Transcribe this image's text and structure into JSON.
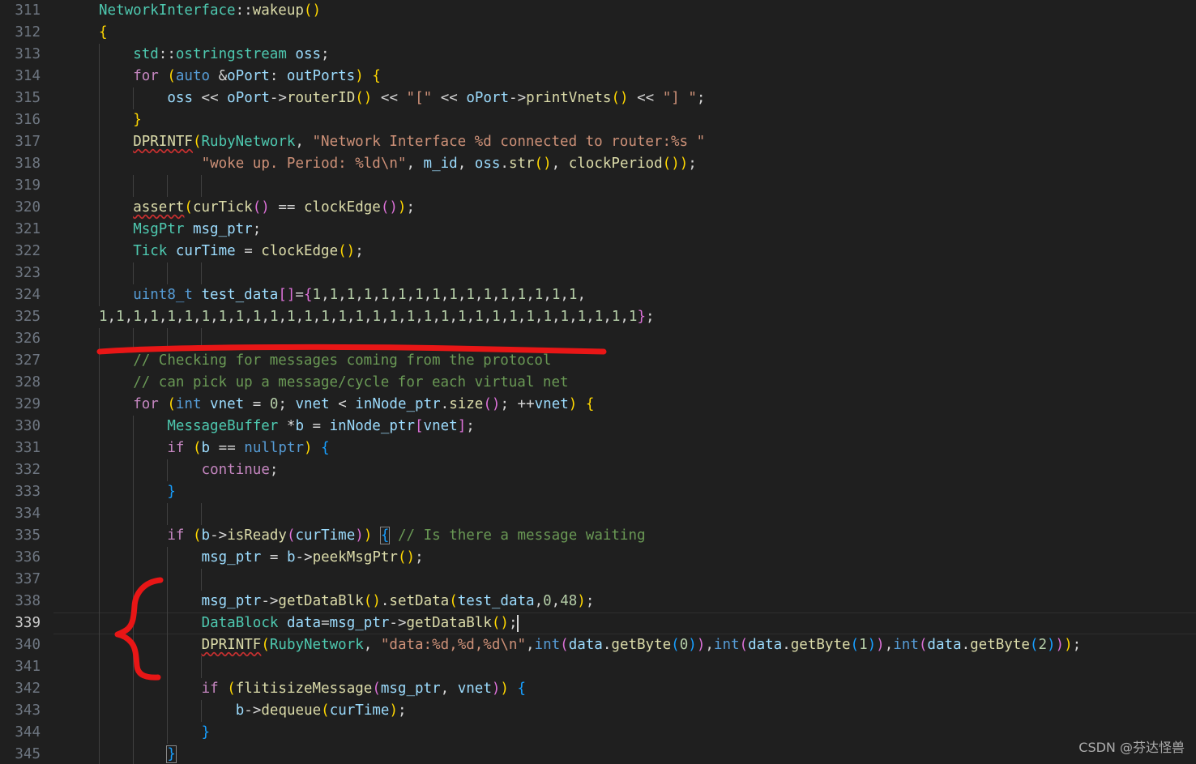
{
  "editor": {
    "language": "cpp",
    "background_color": "#1f1f1f",
    "gutter_color": "#6e7681",
    "active_line_number": 339,
    "first_visible_line": 311,
    "last_visible_line": 345,
    "caret_line": 339,
    "caret_after_text": "DataBlock data=msg_ptr->getDataBlk();"
  },
  "watermark": {
    "text": "CSDN @芬达怪兽"
  },
  "annotations": {
    "underline": {
      "shape": "red-horizontal-underline",
      "color": "#e81616",
      "target_line": 326,
      "description": "Red hand-drawn underline beneath the test_data array declaration"
    },
    "brace": {
      "shape": "red-hand-drawn-curly-brace",
      "color": "#e81616",
      "target_lines": "338-340",
      "description": "Red hand-drawn curly brace marking the three added debug lines"
    }
  },
  "lines": [
    {
      "n": 311,
      "indent": 0,
      "text": "NetworkInterface::wakeup()"
    },
    {
      "n": 312,
      "indent": 0,
      "text": "{"
    },
    {
      "n": 313,
      "indent": 1,
      "text": "std::ostringstream oss;"
    },
    {
      "n": 314,
      "indent": 1,
      "text": "for (auto &oPort: outPorts) {"
    },
    {
      "n": 315,
      "indent": 2,
      "text": "oss << oPort->routerID() << \"[\" << oPort->printVnets() << \"] \";"
    },
    {
      "n": 316,
      "indent": 1,
      "text": "}"
    },
    {
      "n": 317,
      "indent": 1,
      "text": "DPRINTF(RubyNetwork, \"Network Interface %d connected to router:%s \""
    },
    {
      "n": 318,
      "indent": 1,
      "text": "        \"woke up. Period: %ld\\n\", m_id, oss.str(), clockPeriod());"
    },
    {
      "n": 319,
      "indent": 0,
      "text": ""
    },
    {
      "n": 320,
      "indent": 1,
      "text": "assert(curTick() == clockEdge());"
    },
    {
      "n": 321,
      "indent": 1,
      "text": "MsgPtr msg_ptr;"
    },
    {
      "n": 322,
      "indent": 1,
      "text": "Tick curTime = clockEdge();"
    },
    {
      "n": 323,
      "indent": 0,
      "text": ""
    },
    {
      "n": 324,
      "indent": 1,
      "text": "uint8_t test_data[]={1,1,1,1,1,1,1,1,1,1,1,1,1,1,1,1,"
    },
    {
      "n": 325,
      "indent": 0,
      "text": "1,1,1,1,1,1,1,1,1,1,1,1,1,1,1,1,1,1,1,1,1,1,1,1,1,1,1,1,1,1,1,1};"
    },
    {
      "n": 326,
      "indent": 0,
      "text": ""
    },
    {
      "n": 327,
      "indent": 1,
      "text": "// Checking for messages coming from the protocol"
    },
    {
      "n": 328,
      "indent": 1,
      "text": "// can pick up a message/cycle for each virtual net"
    },
    {
      "n": 329,
      "indent": 1,
      "text": "for (int vnet = 0; vnet < inNode_ptr.size(); ++vnet) {"
    },
    {
      "n": 330,
      "indent": 2,
      "text": "MessageBuffer *b = inNode_ptr[vnet];"
    },
    {
      "n": 331,
      "indent": 2,
      "text": "if (b == nullptr) {"
    },
    {
      "n": 332,
      "indent": 3,
      "text": "continue;"
    },
    {
      "n": 333,
      "indent": 2,
      "text": "}"
    },
    {
      "n": 334,
      "indent": 0,
      "text": ""
    },
    {
      "n": 335,
      "indent": 2,
      "text": "if (b->isReady(curTime)) { // Is there a message waiting"
    },
    {
      "n": 336,
      "indent": 3,
      "text": "msg_ptr = b->peekMsgPtr();"
    },
    {
      "n": 337,
      "indent": 0,
      "text": ""
    },
    {
      "n": 338,
      "indent": 3,
      "text": "msg_ptr->getDataBlk().setData(test_data,0,48);"
    },
    {
      "n": 339,
      "indent": 3,
      "text": "DataBlock data=msg_ptr->getDataBlk();"
    },
    {
      "n": 340,
      "indent": 3,
      "text": "DPRINTF(RubyNetwork, \"data:%d,%d,%d\\n\",int(data.getByte(0)),int(data.getByte(1)),int(data.getByte(2)));"
    },
    {
      "n": 341,
      "indent": 0,
      "text": ""
    },
    {
      "n": 342,
      "indent": 3,
      "text": "if (flitisizeMessage(msg_ptr, vnet)) {"
    },
    {
      "n": 343,
      "indent": 4,
      "text": "b->dequeue(curTime);"
    },
    {
      "n": 344,
      "indent": 3,
      "text": "}"
    },
    {
      "n": 345,
      "indent": 2,
      "text": "}"
    }
  ]
}
